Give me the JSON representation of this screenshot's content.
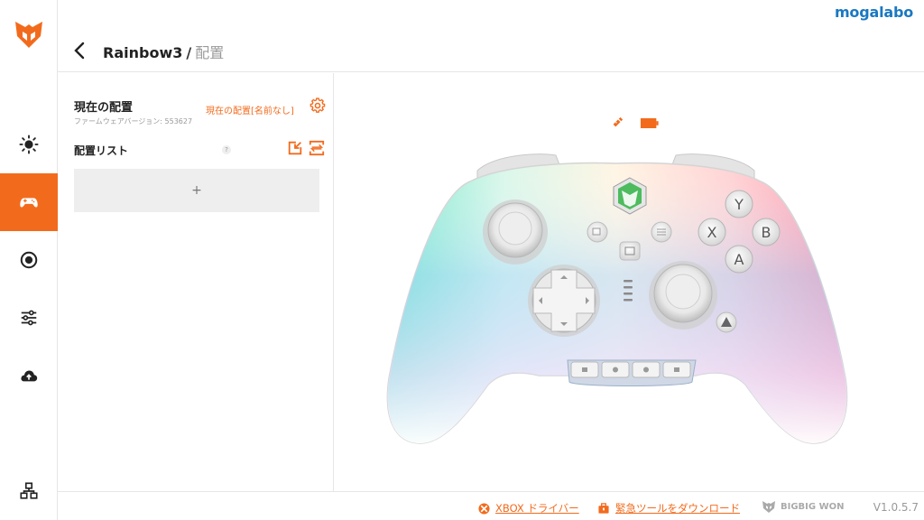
{
  "header": {
    "brand": "mogalabo",
    "breadcrumb_device": "Rainbow3",
    "breadcrumb_sep": "/",
    "breadcrumb_page": "配置"
  },
  "sidebar": {
    "items": [
      {
        "name": "lighting",
        "icon": "sun-icon"
      },
      {
        "name": "gamepad",
        "icon": "gamepad-icon",
        "active": true
      },
      {
        "name": "record",
        "icon": "record-icon"
      },
      {
        "name": "sliders",
        "icon": "sliders-icon"
      },
      {
        "name": "cloud",
        "icon": "cloud-upload-icon"
      },
      {
        "name": "devices",
        "icon": "device-network-icon"
      }
    ]
  },
  "config": {
    "current_title": "現在の配置",
    "firmware": "ファームウェアバージョン: 553627",
    "current_value": "現在の配置[名前なし]",
    "list_title": "配置リスト",
    "help": "?",
    "add": "+"
  },
  "controller": {
    "buttons": {
      "y": "Y",
      "x": "X",
      "b": "B",
      "a": "A"
    }
  },
  "footer": {
    "xbox_link": "XBOX ドライバー",
    "tool_link": "緊急ツールをダウンロード",
    "brand": "BIGBIG WON",
    "version": "V1.0.5.7"
  },
  "colors": {
    "accent": "#f26b1d",
    "brand_blue": "#1a78c2"
  }
}
